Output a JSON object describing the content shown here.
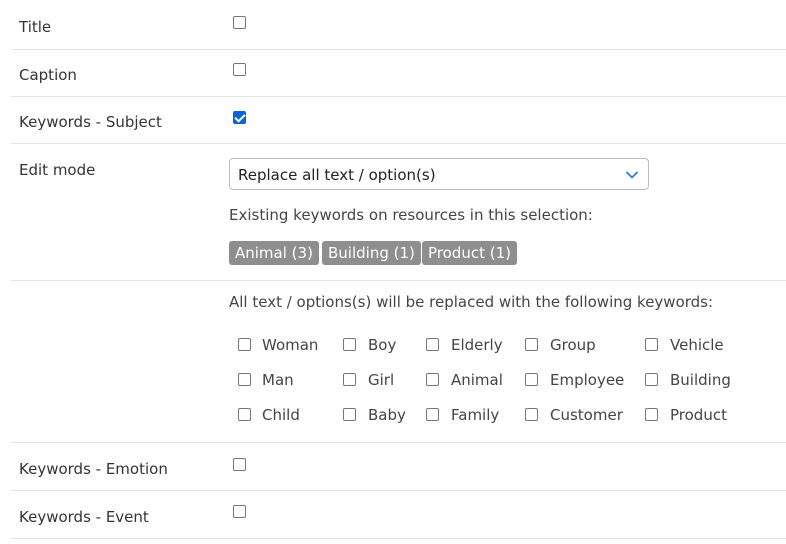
{
  "fields": {
    "title": {
      "label": "Title",
      "checked": false
    },
    "caption": {
      "label": "Caption",
      "checked": false
    },
    "keywords_subject": {
      "label": "Keywords - Subject",
      "checked": true
    },
    "edit_mode": {
      "label": "Edit mode",
      "selected": "Replace all text / option(s)"
    },
    "keywords_emotion": {
      "label": "Keywords - Emotion",
      "checked": false
    },
    "keywords_event": {
      "label": "Keywords - Event",
      "checked": false
    }
  },
  "existing": {
    "heading": "Existing keywords on resources in this selection:",
    "tags": [
      "Animal (3)",
      "Building (1)",
      "Product (1)"
    ]
  },
  "replace": {
    "heading": "All text / options(s) will be replaced with the following keywords:",
    "keywords": [
      [
        "Woman",
        "Boy",
        "Elderly",
        "Group",
        "Vehicle"
      ],
      [
        "Man",
        "Girl",
        "Animal",
        "Employee",
        "Building"
      ],
      [
        "Child",
        "Baby",
        "Family",
        "Customer",
        "Product"
      ]
    ]
  },
  "colors": {
    "tag_bg": "#8e8e8e",
    "checkbox_checked": "#0b63d6",
    "chevron": "#2f7fd0"
  },
  "icons": {
    "dropdown": "chevron-down-icon"
  }
}
